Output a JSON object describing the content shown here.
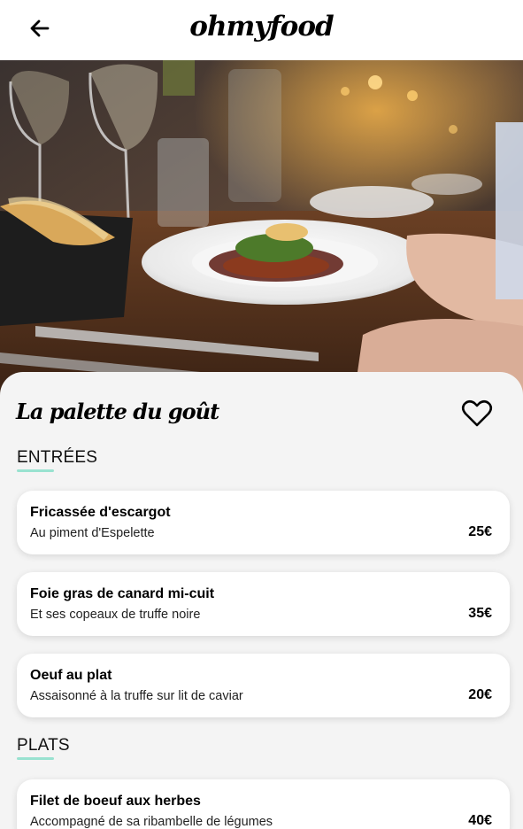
{
  "header": {
    "logo": "ohmyfood",
    "back_icon": "arrow-left-icon"
  },
  "hero": {
    "image": "restaurant-table-plated-dish-photo"
  },
  "restaurant": {
    "name": "La palette du goût",
    "favorite_icon": "heart-icon"
  },
  "sections": [
    {
      "title": "ENTRÉES",
      "dishes": [
        {
          "name": "Fricassée d'escargot",
          "description": "Au piment d'Espelette",
          "price": "25€"
        },
        {
          "name": "Foie gras de canard mi-cuit",
          "description": "Et ses copeaux de truffe noire",
          "price": "35€"
        },
        {
          "name": "Oeuf au plat",
          "description": "Assaisonné à la truffe sur lit de caviar",
          "price": "20€"
        }
      ]
    },
    {
      "title": "PLATS",
      "dishes": [
        {
          "name": "Filet de boeuf aux herbes",
          "description": "Accompagné de sa ribambelle de légumes",
          "price": "40€"
        }
      ]
    }
  ],
  "colors": {
    "accent": "#99e2d0",
    "background": "#f4f4f4",
    "card": "#ffffff"
  }
}
